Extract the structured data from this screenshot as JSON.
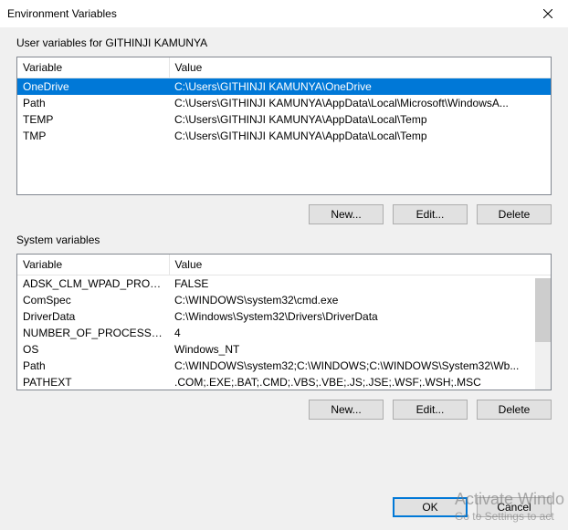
{
  "title": "Environment Variables",
  "close_icon": "x",
  "user": {
    "group_label": "User variables for GITHINJI KAMUNYA",
    "columns": {
      "var": "Variable",
      "val": "Value"
    },
    "rows": [
      {
        "var": "OneDrive",
        "val": "C:\\Users\\GITHINJI KAMUNYA\\OneDrive",
        "selected": true
      },
      {
        "var": "Path",
        "val": "C:\\Users\\GITHINJI KAMUNYA\\AppData\\Local\\Microsoft\\WindowsA...",
        "selected": false
      },
      {
        "var": "TEMP",
        "val": "C:\\Users\\GITHINJI KAMUNYA\\AppData\\Local\\Temp",
        "selected": false
      },
      {
        "var": "TMP",
        "val": "C:\\Users\\GITHINJI KAMUNYA\\AppData\\Local\\Temp",
        "selected": false
      }
    ],
    "buttons": {
      "new": "New...",
      "edit": "Edit...",
      "delete": "Delete"
    }
  },
  "system": {
    "group_label": "System variables",
    "columns": {
      "var": "Variable",
      "val": "Value"
    },
    "rows": [
      {
        "var": "ADSK_CLM_WPAD_PROXY_...",
        "val": "FALSE"
      },
      {
        "var": "ComSpec",
        "val": "C:\\WINDOWS\\system32\\cmd.exe"
      },
      {
        "var": "DriverData",
        "val": "C:\\Windows\\System32\\Drivers\\DriverData"
      },
      {
        "var": "NUMBER_OF_PROCESSORS",
        "val": "4"
      },
      {
        "var": "OS",
        "val": "Windows_NT"
      },
      {
        "var": "Path",
        "val": "C:\\WINDOWS\\system32;C:\\WINDOWS;C:\\WINDOWS\\System32\\Wb..."
      },
      {
        "var": "PATHEXT",
        "val": ".COM;.EXE;.BAT;.CMD;.VBS;.VBE;.JS;.JSE;.WSF;.WSH;.MSC"
      }
    ],
    "buttons": {
      "new": "New...",
      "edit": "Edit...",
      "delete": "Delete"
    }
  },
  "footer": {
    "ok": "OK",
    "cancel": "Cancel"
  },
  "watermark": {
    "line1": "Activate Windo",
    "line2": "Go to Settings to act"
  }
}
